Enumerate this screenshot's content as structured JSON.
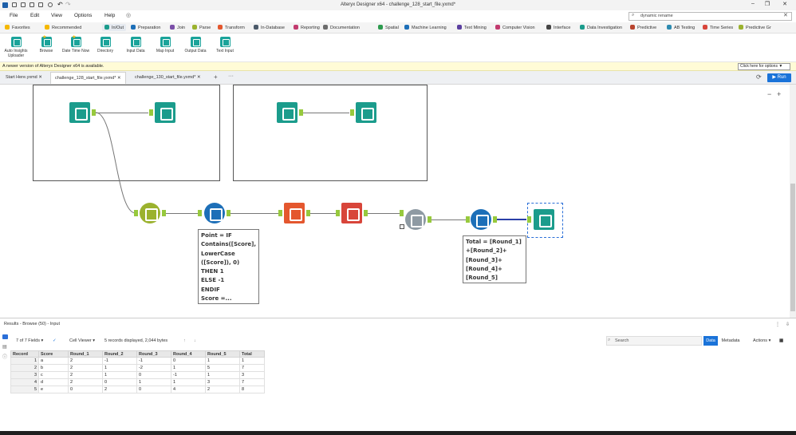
{
  "window": {
    "title": "Alteryx Designer x64 - challenge_128_start_file.yxmd*"
  },
  "menu": [
    "File",
    "Edit",
    "View",
    "Options",
    "Help"
  ],
  "search": {
    "value": "dynamic rename"
  },
  "tabs": [
    {
      "label": "Favorites",
      "color": "#f5b800"
    },
    {
      "label": "Recommended",
      "color": "#f5b800"
    },
    {
      "label": "In/Out",
      "color": "#1b9c8c"
    },
    {
      "label": "Preparation",
      "color": "#1d6fb8"
    },
    {
      "label": "Join",
      "color": "#7b4fa8"
    },
    {
      "label": "Parse",
      "color": "#9bb22e"
    },
    {
      "label": "Transform",
      "color": "#e4572e"
    },
    {
      "label": "In-Database",
      "color": "#4c5a6a"
    },
    {
      "label": "Reporting",
      "color": "#c23b6f"
    },
    {
      "label": "Documentation",
      "color": "#6d6d6d"
    },
    {
      "label": "Spatial",
      "color": "#2d9b4f"
    },
    {
      "label": "Machine Learning",
      "color": "#1d6fb8"
    },
    {
      "label": "Text Mining",
      "color": "#5b3fa0"
    },
    {
      "label": "Computer Vision",
      "color": "#c23b6f"
    },
    {
      "label": "Interface",
      "color": "#444444"
    },
    {
      "label": "Data Investigation",
      "color": "#1b9c8c"
    },
    {
      "label": "Predictive",
      "color": "#b8442e"
    },
    {
      "label": "AB Testing",
      "color": "#2d8bb0"
    },
    {
      "label": "Time Series",
      "color": "#d8453a"
    },
    {
      "label": "Predictive Gr",
      "color": "#9bb22e"
    }
  ],
  "tools": [
    "Auto Insights Uploader",
    "Browse",
    "Date Time Now",
    "Directory",
    "Input Data",
    "Map Input",
    "Output Data",
    "Text Input"
  ],
  "banner": {
    "text": "A newer version of Alteryx Designer x64 is available.",
    "button": "Click here for options"
  },
  "doc_tabs": [
    "Start Here.yxmd",
    "challenge_128_start_file.yxmd*",
    "challenge_130_start_file.yxmd*"
  ],
  "run_label": "Run",
  "annotations": {
    "formula1": [
      "Point = IF",
      "Contains([Score],",
      "LowerCase",
      "([Score]), 0)",
      "THEN 1",
      "ELSE -1",
      "ENDIF",
      "Score =..."
    ],
    "formula2": [
      "Total = [Round_1]",
      "+[Round_2]+",
      "[Round_3]+",
      "[Round_4]+",
      "[Round_5]"
    ]
  },
  "results": {
    "title": "Results - Browse (50) - Input",
    "fields": "7 of 7 Fields",
    "viewer": "Cell Viewer",
    "summary": "5 records displayed, 2,044 bytes",
    "search_placeholder": "Search",
    "data_label": "Data",
    "metadata_label": "Metadata",
    "actions_label": "Actions",
    "columns": [
      "Record",
      "Score",
      "Round_1",
      "Round_2",
      "Round_3",
      "Round_4",
      "Round_5",
      "Total"
    ],
    "rows": [
      [
        "1",
        "a",
        "2",
        "-1",
        "-1",
        "0",
        "1",
        "1"
      ],
      [
        "2",
        "b",
        "2",
        "1",
        "-2",
        "1",
        "5",
        "7"
      ],
      [
        "3",
        "c",
        "2",
        "1",
        "0",
        "-1",
        "1",
        "3"
      ],
      [
        "4",
        "d",
        "2",
        "0",
        "1",
        "1",
        "3",
        "7"
      ],
      [
        "5",
        "e",
        "0",
        "2",
        "0",
        "4",
        "2",
        "8"
      ]
    ]
  }
}
